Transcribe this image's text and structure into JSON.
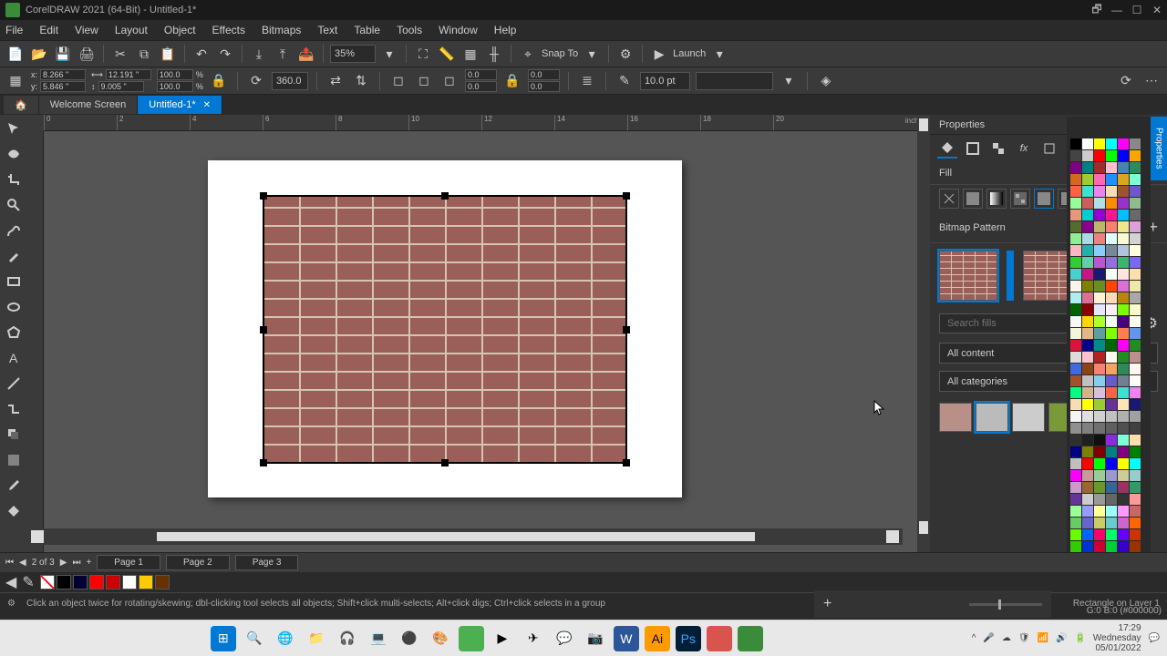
{
  "title": "CorelDRAW 2021 (64-Bit) - Untitled-1*",
  "menu": [
    "File",
    "Edit",
    "View",
    "Layout",
    "Object",
    "Effects",
    "Bitmaps",
    "Text",
    "Table",
    "Tools",
    "Window",
    "Help"
  ],
  "toolbar": {
    "zoom": "35%",
    "snap": "Snap To",
    "launch": "Launch"
  },
  "coords": {
    "x": "8.266 \"",
    "y": "5.846 \"",
    "w": "12.191 \"",
    "h": "9.005 \"",
    "sx": "100.0",
    "sy": "100.0",
    "rot": "360.0",
    "outline": "10.0 pt"
  },
  "tabs": {
    "welcome": "Welcome Screen",
    "doc": "Untitled-1*"
  },
  "properties": {
    "title": "Properties",
    "fill_label": "Fill",
    "pattern_label": "Bitmap Pattern",
    "search_placeholder": "Search fills",
    "filter1": "All content",
    "filter2": "All categories"
  },
  "pages": {
    "counter": "2 of 3",
    "p1": "Page 1",
    "p2": "Page 2",
    "p3": "Page 3"
  },
  "status": {
    "hint": "Click an object twice for rotating/skewing; dbl-clicking tool selects all objects; Shift+click multi-selects; Alt+click digs; Ctrl+click selects in a group",
    "selection": "Rectangle on Layer 1",
    "color": "G:0 B:0 (#000000)"
  },
  "clock": {
    "time": "17:29",
    "day": "Wednesday",
    "date": "05/01/2022"
  },
  "palette_colors": [
    "#000",
    "#fff",
    "#ff0",
    "#0ff",
    "#f0f",
    "#888",
    "#444",
    "#ccc",
    "#f00",
    "#0f0",
    "#00f",
    "#ffa500",
    "#800080",
    "#008080",
    "#a52a2a",
    "#ffc0cb",
    "#4682b4",
    "#2e8b57",
    "#d2691e",
    "#9acd32",
    "#ff69b4",
    "#1e90ff",
    "#daa520",
    "#7fffd4",
    "#ff6347",
    "#40e0d0",
    "#ee82ee",
    "#f5deb3",
    "#a0522d",
    "#6a5acd",
    "#98fb98",
    "#cd5c5c",
    "#b0e0e6",
    "#ff8c00",
    "#9932cc",
    "#8fbc8f",
    "#e9967a",
    "#00ced1",
    "#9400d3",
    "#ff1493",
    "#00bfff",
    "#696969",
    "#556b2f",
    "#8b008b",
    "#bdb76b",
    "#fa8072",
    "#f0e68c",
    "#dda0dd",
    "#90ee90",
    "#add8e6",
    "#f08080",
    "#e0ffff",
    "#fafad2",
    "#d3d3d3",
    "#ffb6c1",
    "#20b2aa",
    "#87cefa",
    "#778899",
    "#b0c4de",
    "#ffffe0",
    "#32cd32",
    "#66cdaa",
    "#ba55d3",
    "#9370db",
    "#3cb371",
    "#7b68ee",
    "#48d1cc",
    "#c71585",
    "#191970",
    "#f5fffa",
    "#ffe4e1",
    "#ffdead",
    "#fdf5e6",
    "#808000",
    "#6b8e23",
    "#ff4500",
    "#da70d6",
    "#eee8aa",
    "#afeeee",
    "#db7093",
    "#ffefd5",
    "#ffdab9",
    "#b8860b",
    "#a9a9a9",
    "#006400",
    "#8b0000",
    "#e6e6fa",
    "#fff0f5",
    "#7cfc00",
    "#fffacd",
    "#f8f8ff",
    "#ffd700",
    "#adff2f",
    "#f0fff0",
    "#4b0082",
    "#fffff0",
    "#f5f5dc",
    "#deb887",
    "#5f9ea0",
    "#7fff00",
    "#ff7f50",
    "#6495ed",
    "#dc143c",
    "#00008b",
    "#008b8b",
    "#006400",
    "#ff00ff",
    "#228b22",
    "#dcdcdc",
    "#ffc0cb",
    "#b22222",
    "#fffaf0",
    "#228b22",
    "#bc8f8f",
    "#4169e1",
    "#8b4513",
    "#fa8072",
    "#f4a460",
    "#2e8b57",
    "#fff5ee",
    "#a0522d",
    "#c0c0c0",
    "#87ceeb",
    "#6a5acd",
    "#708090",
    "#fffafa",
    "#00ff7f",
    "#d2b48c",
    "#d8bfd8",
    "#ff6347",
    "#40e0d0",
    "#ee82ee",
    "#f5deb3",
    "#ffff00",
    "#9acd32",
    "#663399",
    "#ffe4b5",
    "#191970",
    "#f5f5f5",
    "#e0e0e0",
    "#d0d0d0",
    "#c0c0c0",
    "#b0b0b0",
    "#a0a0a0",
    "#909090",
    "#808080",
    "#707070",
    "#606060",
    "#505050",
    "#404040",
    "#303030",
    "#202020",
    "#101010",
    "#8a2be2",
    "#7fffd4",
    "#ffdead",
    "#000080",
    "#808000",
    "#800000",
    "#008080",
    "#800080",
    "#008000",
    "#c0c0c0",
    "#ff0000",
    "#00ff00",
    "#0000ff",
    "#ffff00",
    "#00ffff",
    "#ff00ff",
    "#c99",
    "#9c9",
    "#99c",
    "#cc9",
    "#9cc",
    "#c9c",
    "#963",
    "#693",
    "#369",
    "#936",
    "#396",
    "#639",
    "#ccc",
    "#999",
    "#666",
    "#333",
    "#f99",
    "#9f9",
    "#99f",
    "#ff9",
    "#9ff",
    "#f9f",
    "#c66",
    "#6c6",
    "#66c",
    "#cc6",
    "#6cc",
    "#c6c",
    "#f60",
    "#6f0",
    "#06f",
    "#f06",
    "#0f6",
    "#60f",
    "#c30",
    "#3c0",
    "#03c",
    "#c03",
    "#0c3",
    "#30c",
    "#930",
    "#390",
    "#039",
    "#903",
    "#093",
    "#309",
    "#f93",
    "#9f3",
    "#39f",
    "#f39",
    "#3f9",
    "#93f",
    "#f96",
    "#9f6",
    "#69f",
    "#f69",
    "#6f9",
    "#96f",
    "#c63",
    "#6c3",
    "#36c"
  ]
}
